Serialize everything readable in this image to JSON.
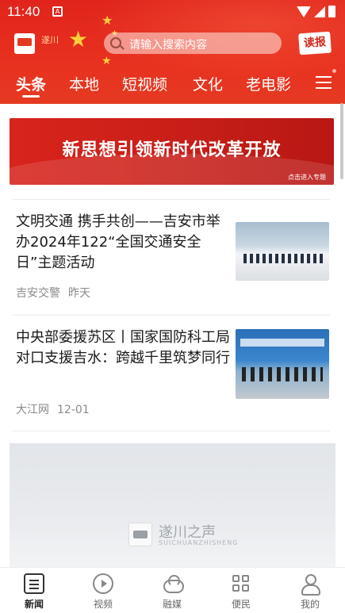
{
  "status_bar": {
    "time": "11:40",
    "notification_glyph": "A"
  },
  "header": {
    "logo_caption": "遂川",
    "search": {
      "placeholder": "请输入搜索内容"
    },
    "dubao_label": "读报",
    "tabs": [
      {
        "label": "头条",
        "active": true
      },
      {
        "label": "本地",
        "active": false
      },
      {
        "label": "短视频",
        "active": false
      },
      {
        "label": "文化",
        "active": false
      },
      {
        "label": "老电影",
        "active": false
      }
    ]
  },
  "banner": {
    "title": "新思想引领新时代改革开放",
    "cta": "点击进入专题"
  },
  "news": [
    {
      "title": "文明交通 携手共创——吉安市举办2024年122“全国交通安全日”主题活动",
      "source": "吉安交警",
      "time": "昨天"
    },
    {
      "title": "中央部委援苏区丨国家国防科工局对口支援吉水：跨越千里筑梦同行",
      "source": "大江网",
      "time": "12-01"
    }
  ],
  "placeholder": {
    "brand": "遂川之声",
    "brand_pinyin": "SUICHUANZHISHENG"
  },
  "bottom_nav": [
    {
      "label": "新闻",
      "icon": "news-icon",
      "active": true
    },
    {
      "label": "视频",
      "icon": "video-icon",
      "active": false
    },
    {
      "label": "融媒",
      "icon": "cloud-icon",
      "active": false
    },
    {
      "label": "便民",
      "icon": "grid-icon",
      "active": false
    },
    {
      "label": "我的",
      "icon": "user-icon",
      "active": false
    }
  ],
  "colors": {
    "brand_red": "#e0241c",
    "banner_red": "#c91f18",
    "text_dark": "#1a1a1a",
    "text_meta": "#8a8a8a"
  }
}
